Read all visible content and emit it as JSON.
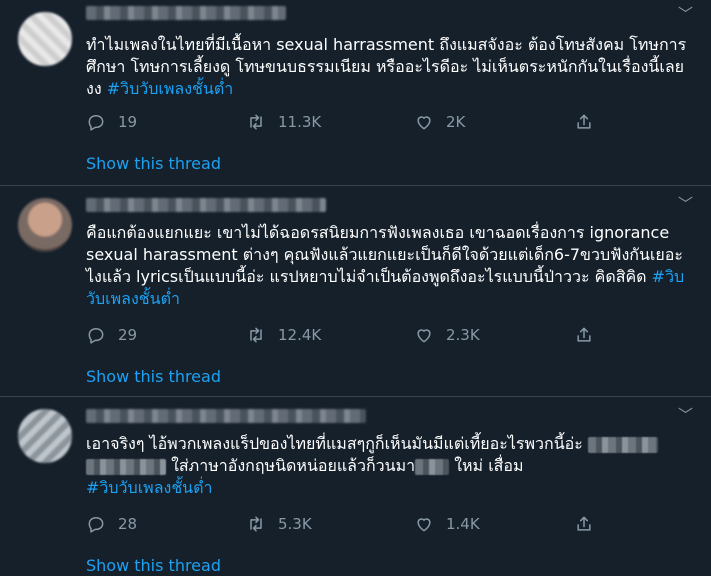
{
  "tweets": [
    {
      "text": "ทำไมเพลงในไทยที่มีเนื้อหา sexual harrassment ถึงแมสจังอะ ต้องโทษสังคม โทษการศึกษา โทษการเลี้ยงดู โทษขนบธรรมเนียม หรืออะไรดีอะ ไม่เห็นตระหนักกันในเรื่องนี้เลย งง ",
      "hashtag": "#วิบวับเพลงชั้นต่ำ",
      "replies": "19",
      "retweets": "11.3K",
      "likes": "2K",
      "show_thread": "Show this thread"
    },
    {
      "text": "คือแกต้องแยกแยะ เขาไม่ได้ฉอดรสนิยมการฟังเพลงเธอ เขาฉอดเรื่องการ ignorance sexual harassment  ต่างๆ คุณฟังแล้วแยกแยะเป็นก็ดีใจด้วยแต่เด็ก6-7ขวบฟังกันเยอะไงแล้ว lyricsเป็นแบบนี้อ่ะ แรปหยาบไม่จำเป็นต้องพูดถึงอะไรแบบนี้ป่าววะ คิดสิคิด ",
      "hashtag": "#วิบวับเพลงชั้นต่ำ",
      "replies": "29",
      "retweets": "12.4K",
      "likes": "2.3K",
      "show_thread": "Show this thread"
    },
    {
      "text_a": "เอาจริงๆ ไอ้พวกเพลงแร็ปของไทยที่แมสๆกูก็เห็นมันมีแต่เที้ยอะไรพวกนี้อ่ะ ",
      "text_b": " ใส่ภาษาอังกฤษนิดหน่อยแล้วก็วนมา",
      "text_c": " ใหม่ เสื่อม",
      "hashtag": "#วิบวับเพลงชั้นต่ำ",
      "replies": "28",
      "retweets": "5.3K",
      "likes": "1.4K",
      "show_thread": "Show this thread"
    }
  ],
  "icons": {
    "reply": "reply-icon",
    "retweet": "retweet-icon",
    "like": "heart-icon",
    "share": "share-icon",
    "more": "chevron-down-icon"
  },
  "colors": {
    "background": "#15202b",
    "link": "#1da1f2",
    "muted": "#8899a6",
    "divider": "#38444d"
  }
}
